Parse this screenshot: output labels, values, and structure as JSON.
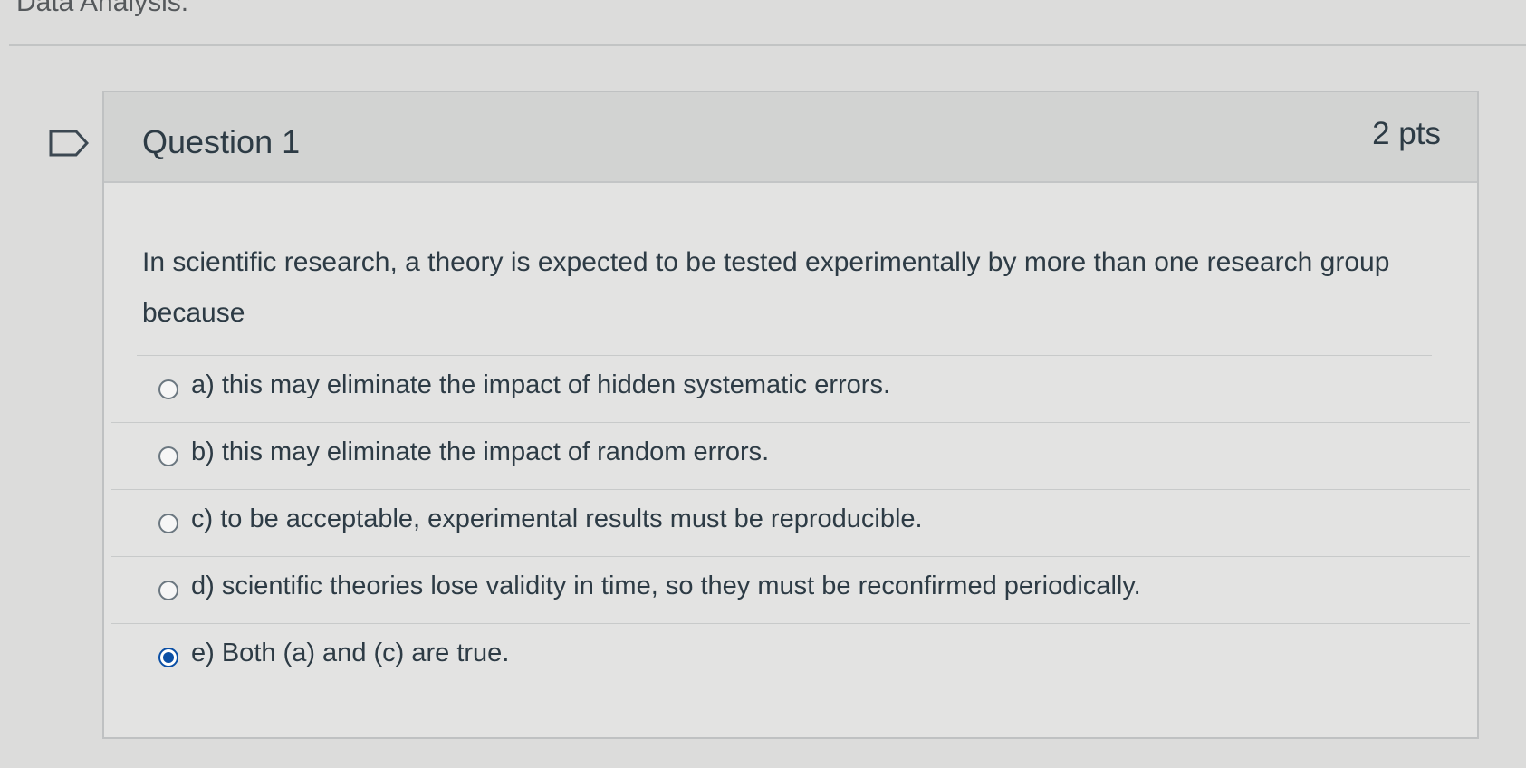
{
  "page": {
    "heading": "Data Analysis."
  },
  "question": {
    "title": "Question 1",
    "points": "2 pts",
    "text": "In scientific research, a theory is expected to be tested experimentally by more than one research group because",
    "flag_icon": "bookmark-flag-icon",
    "answers": [
      {
        "label": "a) this may eliminate the impact of hidden systematic errors.",
        "selected": false
      },
      {
        "label": "b) this may eliminate the impact of random errors.",
        "selected": false
      },
      {
        "label": "c) to be acceptable, experimental results must be reproducible.",
        "selected": false
      },
      {
        "label": "d) scientific theories lose validity in time, so they must be reconfirmed periodically.",
        "selected": false
      },
      {
        "label": "e) Both (a) and (c) are true.",
        "selected": true
      }
    ],
    "accent_color": "#0b4fa5"
  }
}
